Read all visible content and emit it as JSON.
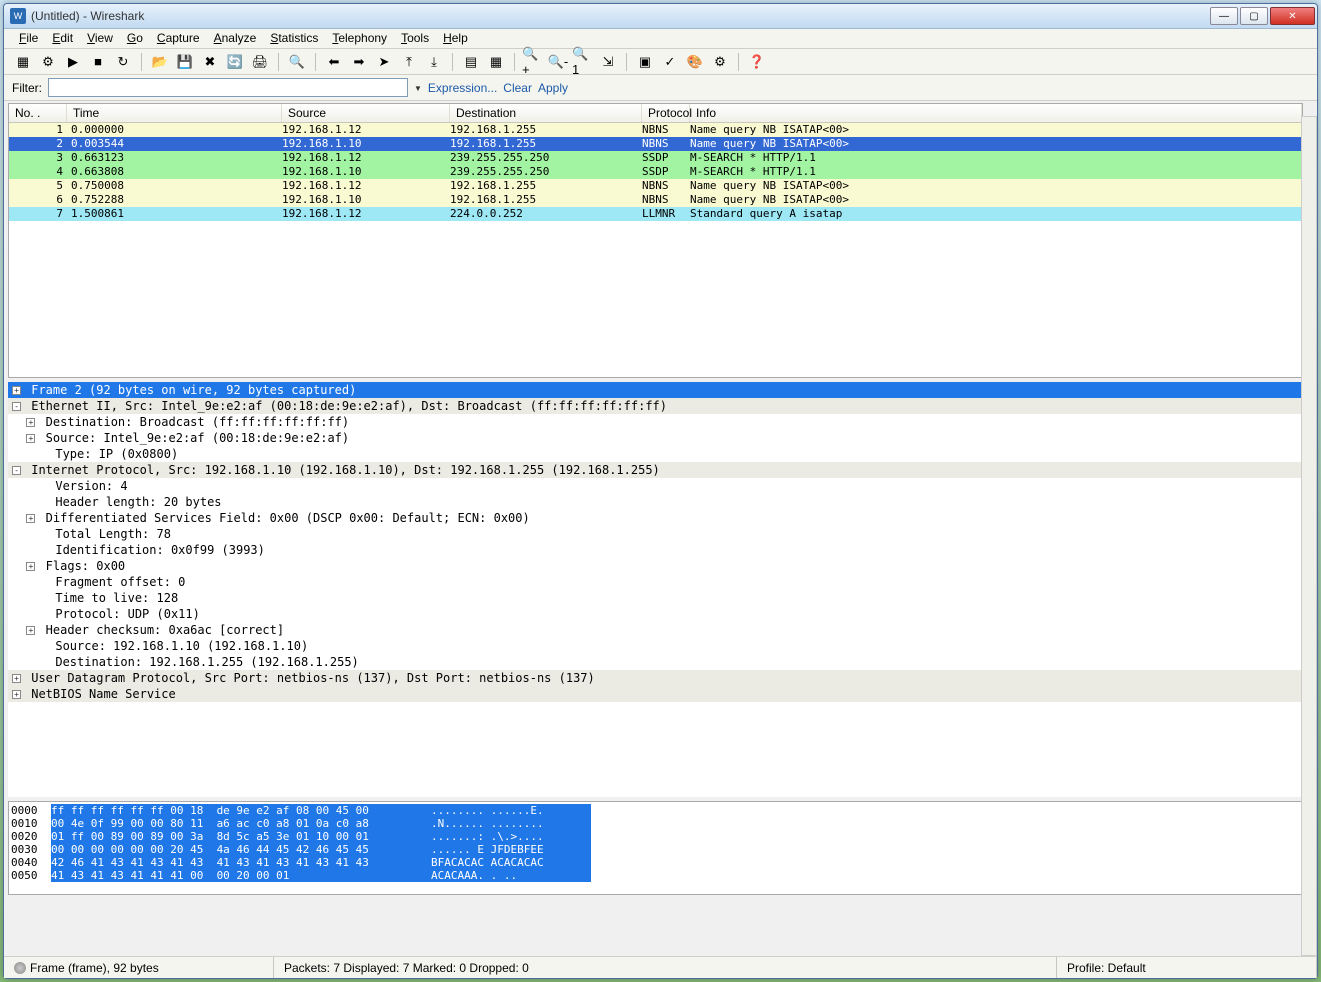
{
  "title": "(Untitled) - Wireshark",
  "menu": [
    "File",
    "Edit",
    "View",
    "Go",
    "Capture",
    "Analyze",
    "Statistics",
    "Telephony",
    "Tools",
    "Help"
  ],
  "filter": {
    "label": "Filter:",
    "value": "",
    "actions": [
      "Expression...",
      "Clear",
      "Apply"
    ]
  },
  "columns": [
    "No. .",
    "Time",
    "Source",
    "Destination",
    "Protocol",
    "Info"
  ],
  "packets": [
    {
      "no": "1",
      "time": "0.000000",
      "src": "192.168.1.12",
      "dst": "192.168.1.255",
      "proto": "NBNS",
      "info": "Name query NB ISATAP<00>",
      "cls": "yellow"
    },
    {
      "no": "2",
      "time": "0.003544",
      "src": "192.168.1.10",
      "dst": "192.168.1.255",
      "proto": "NBNS",
      "info": "Name query NB ISATAP<00>",
      "cls": "selected"
    },
    {
      "no": "3",
      "time": "0.663123",
      "src": "192.168.1.12",
      "dst": "239.255.255.250",
      "proto": "SSDP",
      "info": "M-SEARCH * HTTP/1.1",
      "cls": "green"
    },
    {
      "no": "4",
      "time": "0.663808",
      "src": "192.168.1.10",
      "dst": "239.255.255.250",
      "proto": "SSDP",
      "info": "M-SEARCH * HTTP/1.1",
      "cls": "green"
    },
    {
      "no": "5",
      "time": "0.750008",
      "src": "192.168.1.12",
      "dst": "192.168.1.255",
      "proto": "NBNS",
      "info": "Name query NB ISATAP<00>",
      "cls": "yellow"
    },
    {
      "no": "6",
      "time": "0.752288",
      "src": "192.168.1.10",
      "dst": "192.168.1.255",
      "proto": "NBNS",
      "info": "Name query NB ISATAP<00>",
      "cls": "yellow"
    },
    {
      "no": "7",
      "time": "1.500861",
      "src": "192.168.1.12",
      "dst": "224.0.0.252",
      "proto": "LLMNR",
      "info": "Standard query A isatap",
      "cls": "cyan"
    }
  ],
  "tree": [
    {
      "exp": "+",
      "indent": 0,
      "text": "Frame 2 (92 bytes on wire, 92 bytes captured)",
      "cls": "selected"
    },
    {
      "exp": "-",
      "indent": 0,
      "text": "Ethernet II, Src: Intel_9e:e2:af (00:18:de:9e:e2:af), Dst: Broadcast (ff:ff:ff:ff:ff:ff)",
      "cls": "sec"
    },
    {
      "exp": "+",
      "indent": 1,
      "text": "Destination: Broadcast (ff:ff:ff:ff:ff:ff)",
      "cls": ""
    },
    {
      "exp": "+",
      "indent": 1,
      "text": "Source: Intel_9e:e2:af (00:18:de:9e:e2:af)",
      "cls": ""
    },
    {
      "exp": "",
      "indent": 1,
      "text": "Type: IP (0x0800)",
      "cls": ""
    },
    {
      "exp": "-",
      "indent": 0,
      "text": "Internet Protocol, Src: 192.168.1.10 (192.168.1.10), Dst: 192.168.1.255 (192.168.1.255)",
      "cls": "sec"
    },
    {
      "exp": "",
      "indent": 1,
      "text": "Version: 4",
      "cls": ""
    },
    {
      "exp": "",
      "indent": 1,
      "text": "Header length: 20 bytes",
      "cls": ""
    },
    {
      "exp": "+",
      "indent": 1,
      "text": "Differentiated Services Field: 0x00 (DSCP 0x00: Default; ECN: 0x00)",
      "cls": ""
    },
    {
      "exp": "",
      "indent": 1,
      "text": "Total Length: 78",
      "cls": ""
    },
    {
      "exp": "",
      "indent": 1,
      "text": "Identification: 0x0f99 (3993)",
      "cls": ""
    },
    {
      "exp": "+",
      "indent": 1,
      "text": "Flags: 0x00",
      "cls": ""
    },
    {
      "exp": "",
      "indent": 1,
      "text": "Fragment offset: 0",
      "cls": ""
    },
    {
      "exp": "",
      "indent": 1,
      "text": "Time to live: 128",
      "cls": ""
    },
    {
      "exp": "",
      "indent": 1,
      "text": "Protocol: UDP (0x11)",
      "cls": ""
    },
    {
      "exp": "+",
      "indent": 1,
      "text": "Header checksum: 0xa6ac [correct]",
      "cls": ""
    },
    {
      "exp": "",
      "indent": 1,
      "text": "Source: 192.168.1.10 (192.168.1.10)",
      "cls": ""
    },
    {
      "exp": "",
      "indent": 1,
      "text": "Destination: 192.168.1.255 (192.168.1.255)",
      "cls": ""
    },
    {
      "exp": "+",
      "indent": 0,
      "text": "User Datagram Protocol, Src Port: netbios-ns (137), Dst Port: netbios-ns (137)",
      "cls": "sec"
    },
    {
      "exp": "+",
      "indent": 0,
      "text": "NetBIOS Name Service",
      "cls": "sec"
    }
  ],
  "hex": [
    {
      "off": "0000",
      "bytes": "ff ff ff ff ff ff 00 18  de 9e e2 af 08 00 45 00",
      "ascii": "........ ......E."
    },
    {
      "off": "0010",
      "bytes": "00 4e 0f 99 00 00 80 11  a6 ac c0 a8 01 0a c0 a8",
      "ascii": ".N...... ........"
    },
    {
      "off": "0020",
      "bytes": "01 ff 00 89 00 89 00 3a  8d 5c a5 3e 01 10 00 01",
      "ascii": ".......: .\\.>...."
    },
    {
      "off": "0030",
      "bytes": "00 00 00 00 00 00 20 45  4a 46 44 45 42 46 45 45",
      "ascii": "...... E JFDEBFEE"
    },
    {
      "off": "0040",
      "bytes": "42 46 41 43 41 43 41 43  41 43 41 43 41 43 41 43",
      "ascii": "BFACACAC ACACACAC"
    },
    {
      "off": "0050",
      "bytes": "41 43 41 43 41 41 41 00  00 20 00 01",
      "ascii": "ACACAAA. . .."
    }
  ],
  "status": {
    "left": "Frame (frame), 92 bytes",
    "mid": "Packets: 7 Displayed: 7 Marked: 0 Dropped: 0",
    "right": "Profile: Default"
  },
  "toolbar_icons": [
    "list-interfaces-icon",
    "capture-options-icon",
    "start-capture-icon",
    "stop-capture-icon",
    "restart-capture-icon",
    "open-file-icon",
    "save-file-icon",
    "close-file-icon",
    "reload-icon",
    "print-icon",
    "find-icon",
    "go-back-icon",
    "go-forward-icon",
    "go-to-icon",
    "go-first-icon",
    "go-last-icon",
    "colorize-icon",
    "auto-scroll-icon",
    "zoom-in-icon",
    "zoom-out-icon",
    "zoom-reset-icon",
    "resize-columns-icon",
    "capture-filter-icon",
    "display-filter-icon",
    "coloring-rules-icon",
    "preferences-icon",
    "help-icon"
  ]
}
